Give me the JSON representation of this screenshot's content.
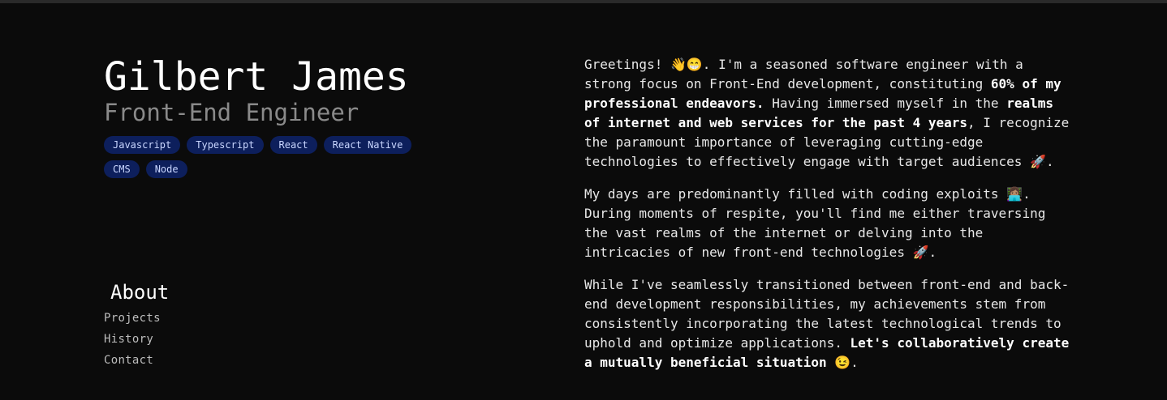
{
  "profile": {
    "name": "Gilbert James",
    "role": "Front-End Engineer",
    "tags": [
      "Javascript",
      "Typescript",
      "React",
      "React Native",
      "CMS",
      "Node"
    ]
  },
  "nav": {
    "active": "About",
    "items": [
      "Projects",
      "History",
      "Contact"
    ]
  },
  "about": {
    "p1": {
      "t1": "Greetings! 👋😁. I'm a seasoned software engineer with a strong focus on Front-End development, constituting ",
      "b1": "60% of my professional endeavors.",
      "t2": " Having immersed myself in the ",
      "b2": "realms of internet and web services for the past 4 years",
      "t3": ", I recognize the paramount importance of leveraging cutting-edge technologies to effectively engage with target audiences 🚀."
    },
    "p2": "My days are predominantly filled with coding exploits 👩🏽‍💻. During moments of respite, you'll find me either traversing the vast realms of the internet or delving into the intricacies of new front-end technologies 🚀.",
    "p3": {
      "t1": "While I've seamlessly transitioned between front-end and back-end development responsibilities, my achievements stem from consistently incorporating the latest technological trends to uphold and optimize applications. ",
      "b1": "Let's collaboratively create a mutually beneficial situation",
      "t2": " 😉."
    }
  }
}
